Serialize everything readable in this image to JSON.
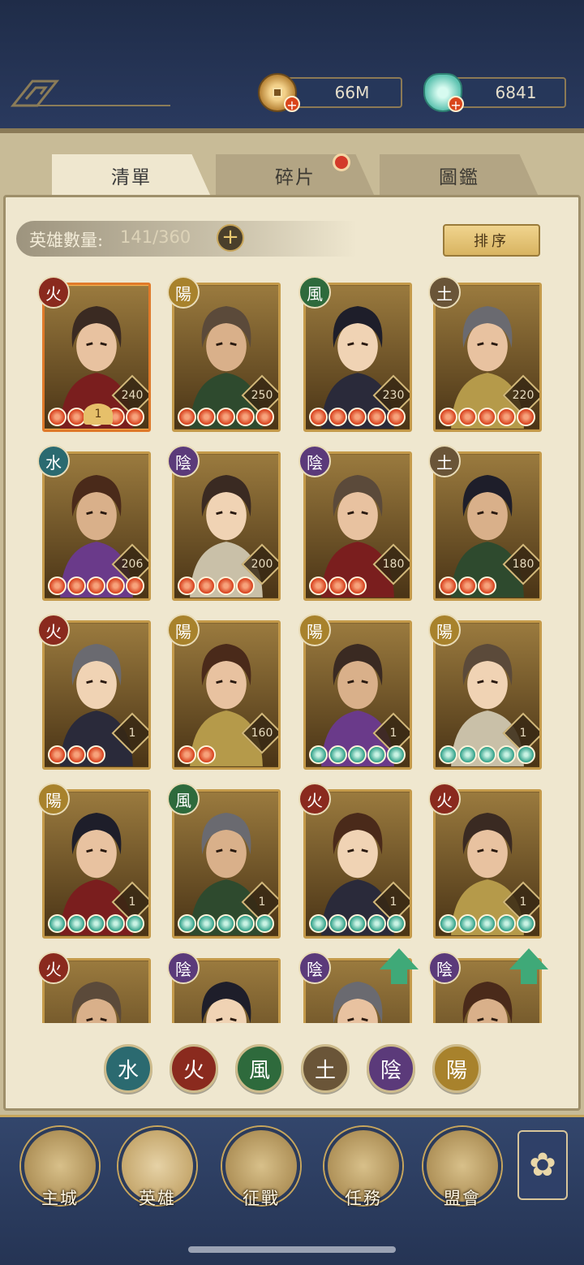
{
  "resources": {
    "coins": "66M",
    "jade": "6841"
  },
  "tabs": [
    {
      "label": "清單",
      "active": true
    },
    {
      "label": "碎片",
      "active": false,
      "notification": true
    },
    {
      "label": "圖鑑",
      "active": false
    }
  ],
  "hero_count": {
    "label": "英雄數量:",
    "value": "141/360"
  },
  "sort_label": "排序",
  "element_glyphs": {
    "fire": "火",
    "yang": "陽",
    "wind": "風",
    "earth": "土",
    "water": "水",
    "yin": "陰"
  },
  "heroes": [
    {
      "element": "fire",
      "level": "240",
      "stars": 5,
      "star_color": "red",
      "selected": true,
      "rank": "1"
    },
    {
      "element": "yang",
      "level": "250",
      "stars": 5,
      "star_color": "red"
    },
    {
      "element": "wind",
      "level": "230",
      "stars": 5,
      "star_color": "red"
    },
    {
      "element": "earth",
      "level": "220",
      "stars": 5,
      "star_color": "red"
    },
    {
      "element": "water",
      "level": "206",
      "stars": 5,
      "star_color": "red"
    },
    {
      "element": "yin",
      "level": "200",
      "stars": 4,
      "star_color": "red"
    },
    {
      "element": "yin",
      "level": "180",
      "stars": 3,
      "star_color": "red"
    },
    {
      "element": "earth",
      "level": "180",
      "stars": 3,
      "star_color": "red"
    },
    {
      "element": "fire",
      "level": "1",
      "stars": 3,
      "star_color": "red"
    },
    {
      "element": "yang",
      "level": "160",
      "stars": 2,
      "star_color": "red"
    },
    {
      "element": "yang",
      "level": "1",
      "stars": 5,
      "star_color": "teal"
    },
    {
      "element": "yang",
      "level": "1",
      "stars": 5,
      "star_color": "teal"
    },
    {
      "element": "yang",
      "level": "1",
      "stars": 5,
      "star_color": "teal"
    },
    {
      "element": "wind",
      "level": "1",
      "stars": 5,
      "star_color": "teal"
    },
    {
      "element": "fire",
      "level": "1",
      "stars": 5,
      "star_color": "teal"
    },
    {
      "element": "fire",
      "level": "1",
      "stars": 5,
      "star_color": "teal"
    },
    {
      "element": "fire",
      "level": "",
      "stars": 0,
      "star_color": "red"
    },
    {
      "element": "yin",
      "level": "",
      "stars": 0,
      "star_color": "red"
    },
    {
      "element": "yin",
      "level": "",
      "stars": 0,
      "star_color": "red",
      "upgradable": true
    },
    {
      "element": "yin",
      "level": "",
      "stars": 0,
      "star_color": "red",
      "upgradable": true
    }
  ],
  "filters": [
    "water",
    "fire",
    "wind",
    "earth",
    "yin",
    "yang"
  ],
  "nav": [
    {
      "label": "主城",
      "icon": "city-gate-icon"
    },
    {
      "label": "英雄",
      "icon": "hero-portrait-icon",
      "active": true
    },
    {
      "label": "征戰",
      "icon": "war-drum-icon"
    },
    {
      "label": "任務",
      "icon": "scroll-bell-icon"
    },
    {
      "label": "盟會",
      "icon": "alliance-pavilion-icon"
    }
  ],
  "colors": {
    "background": "#2b3a5c",
    "panel": "#efe7cf",
    "gold": "#c8a65c",
    "star_red": "#d63d1a",
    "star_teal": "#2d9e86"
  }
}
